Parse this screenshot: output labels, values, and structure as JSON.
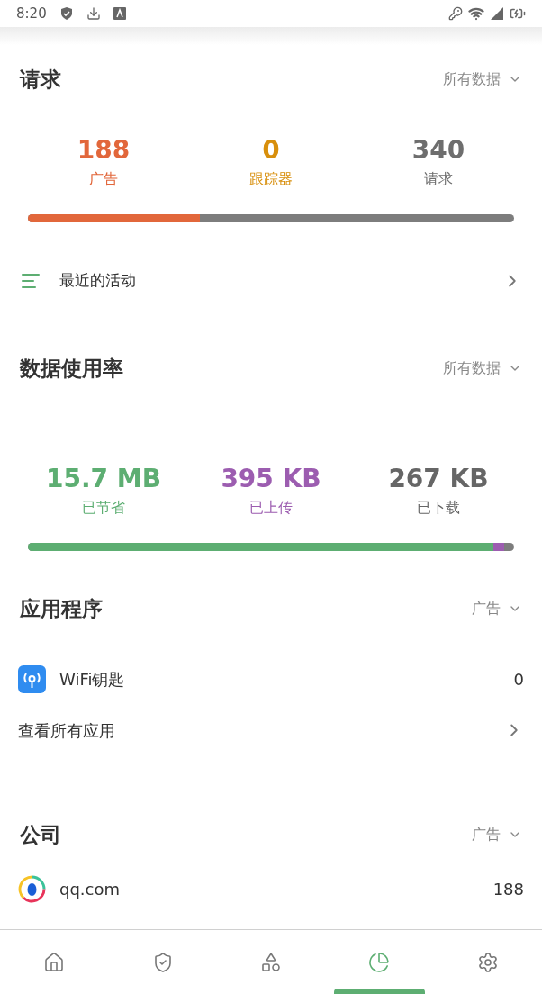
{
  "status_bar": {
    "time": "8:20"
  },
  "requests": {
    "title": "请求",
    "filter": "所有数据",
    "stats": [
      {
        "value": "188",
        "label": "广告",
        "color": "#e2673b"
      },
      {
        "value": "0",
        "label": "跟踪器",
        "color": "#d88f0c"
      },
      {
        "value": "340",
        "label": "请求",
        "color": "#6e6e6e"
      }
    ],
    "bar": [
      {
        "level": 0.354,
        "color": "#e2673b"
      }
    ],
    "recent": "最近的活动"
  },
  "data_usage": {
    "title": "数据使用率",
    "filter": "所有数据",
    "stats": [
      {
        "value": "15.7 MB",
        "label": "已节省",
        "color": "#5dae72"
      },
      {
        "value": "395 KB",
        "label": "已上传",
        "color": "#9c5db0"
      },
      {
        "value": "267 KB",
        "label": "已下载",
        "color": "#666666"
      }
    ],
    "bar": [
      {
        "level": 0.958,
        "color": "#5dae72"
      },
      {
        "color": "#9c5db0"
      }
    ]
  },
  "apps": {
    "title": "应用程序",
    "filter": "广告",
    "items": [
      {
        "name": "WiFi钥匙",
        "count": "0"
      }
    ],
    "see_all": "查看所有应用"
  },
  "companies": {
    "title": "公司",
    "filter": "广告",
    "items": [
      {
        "name": "qq.com",
        "count": "188"
      }
    ]
  },
  "nav": [
    {
      "kind": "home",
      "selected": false
    },
    {
      "kind": "shield",
      "selected": false
    },
    {
      "kind": "apps",
      "selected": false
    },
    {
      "kind": "stats",
      "selected": true
    },
    {
      "kind": "settings",
      "selected": false
    }
  ]
}
